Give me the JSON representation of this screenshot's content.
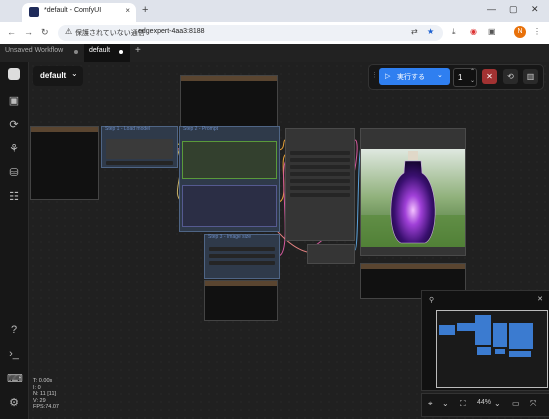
{
  "browser": {
    "tab_title": "*default - ComfyUI",
    "tab_close": "×",
    "new_tab": "+",
    "window_controls": [
      "—",
      "▢",
      "✕"
    ],
    "nav_icons": [
      "←",
      "→",
      "↻"
    ],
    "insecure_label": "保護されていない通信",
    "url": "edgexpert-4aa3:8188",
    "profile_initial": "N"
  },
  "workflow_tabs": [
    {
      "label": "Unsaved Workflow"
    },
    {
      "label": "default"
    }
  ],
  "workflow_add": "+",
  "workflow_selector": {
    "label": "default",
    "caret": "⌄"
  },
  "run_toolbar": {
    "run_label": "実行する",
    "run_caret": "⌄",
    "queue_count": "1",
    "stop": "✕",
    "history": "⟲",
    "panel": "▥"
  },
  "nodes": {
    "step1": "Step 1 - Load model",
    "step2": "Step 2 - Prompt",
    "step3": "Step 3 - Image size"
  },
  "stats": [
    "T: 0.00s",
    "I: 0",
    "N: 11 [11]",
    "V: 29",
    "FPS:74.07"
  ],
  "bottom_toolbar": {
    "zoom": "44%"
  },
  "minimap": {
    "close": "✕"
  }
}
